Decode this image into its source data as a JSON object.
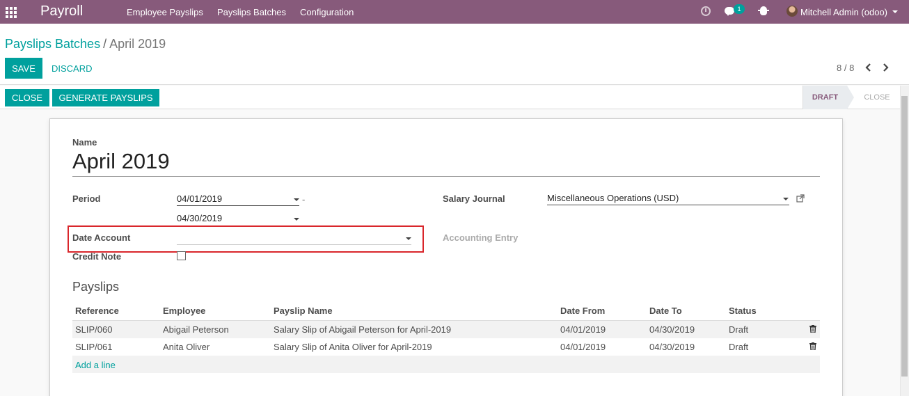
{
  "navbar": {
    "app_name": "Payroll",
    "menu": [
      "Employee Payslips",
      "Payslips Batches",
      "Configuration"
    ],
    "chat_count": "1",
    "user": "Mitchell Admin (odoo)"
  },
  "breadcrumb": {
    "parent": "Payslips Batches",
    "separator": "/",
    "current": "April 2019"
  },
  "actions": {
    "save": "SAVE",
    "discard": "DISCARD"
  },
  "pager": {
    "text": "8 / 8"
  },
  "statusbar": {
    "buttons": [
      "CLOSE",
      "GENERATE PAYSLIPS"
    ],
    "stages": [
      "DRAFT",
      "CLOSE"
    ],
    "active_stage": "DRAFT"
  },
  "form": {
    "name_label": "Name",
    "name_value": "April 2019",
    "period_label": "Period",
    "period_from": "04/01/2019",
    "period_sep": "-",
    "period_to": "04/30/2019",
    "date_account_label": "Date Account",
    "date_account_value": "",
    "credit_note_label": "Credit Note",
    "credit_note_checked": false,
    "salary_journal_label": "Salary Journal",
    "salary_journal_value": "Miscellaneous Operations (USD)",
    "accounting_entry_label": "Accounting Entry"
  },
  "payslips": {
    "title": "Payslips",
    "columns": [
      "Reference",
      "Employee",
      "Payslip Name",
      "Date From",
      "Date To",
      "Status"
    ],
    "rows": [
      [
        "SLIP/060",
        "Abigail Peterson",
        "Salary Slip of Abigail Peterson for April-2019",
        "04/01/2019",
        "04/30/2019",
        "Draft"
      ],
      [
        "SLIP/061",
        "Anita Oliver",
        "Salary Slip of Anita Oliver for April-2019",
        "04/01/2019",
        "04/30/2019",
        "Draft"
      ]
    ],
    "add_line": "Add a line"
  },
  "colors": {
    "brand": "#875a7b",
    "accent": "#00a09d",
    "highlight": "#d9262b"
  },
  "icons": [
    "apps-icon",
    "clock-icon",
    "chat-icon",
    "bug-icon",
    "avatar",
    "chevron-left-icon",
    "chevron-right-icon",
    "external-link-icon",
    "trash-icon",
    "caret-down-icon"
  ]
}
